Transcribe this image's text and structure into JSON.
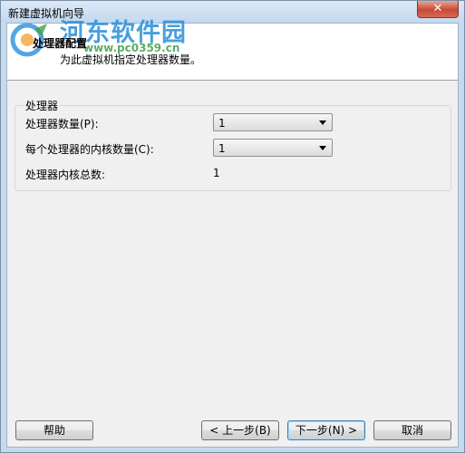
{
  "window": {
    "title": "新建虚拟机向导",
    "close_glyph": "✕"
  },
  "header": {
    "title": "处理器配置",
    "subtitle": "为此虚拟机指定处理器数量。"
  },
  "watermark": {
    "brand": "河东软件园",
    "url": "www.pc0359.cn"
  },
  "processor_group": {
    "legend": "处理器",
    "count_label": "处理器数量(P):",
    "count_value": "1",
    "cores_label": "每个处理器的内核数量(C):",
    "cores_value": "1",
    "total_label": "处理器内核总数:",
    "total_value": "1"
  },
  "buttons": {
    "help": "帮助",
    "back": "< 上一步(B)",
    "next": "下一步(N) >",
    "cancel": "取消"
  },
  "colors": {
    "accent": "#3c7fb1",
    "watermark_blue": "#2a8fd8",
    "watermark_green": "#3fa04a"
  }
}
